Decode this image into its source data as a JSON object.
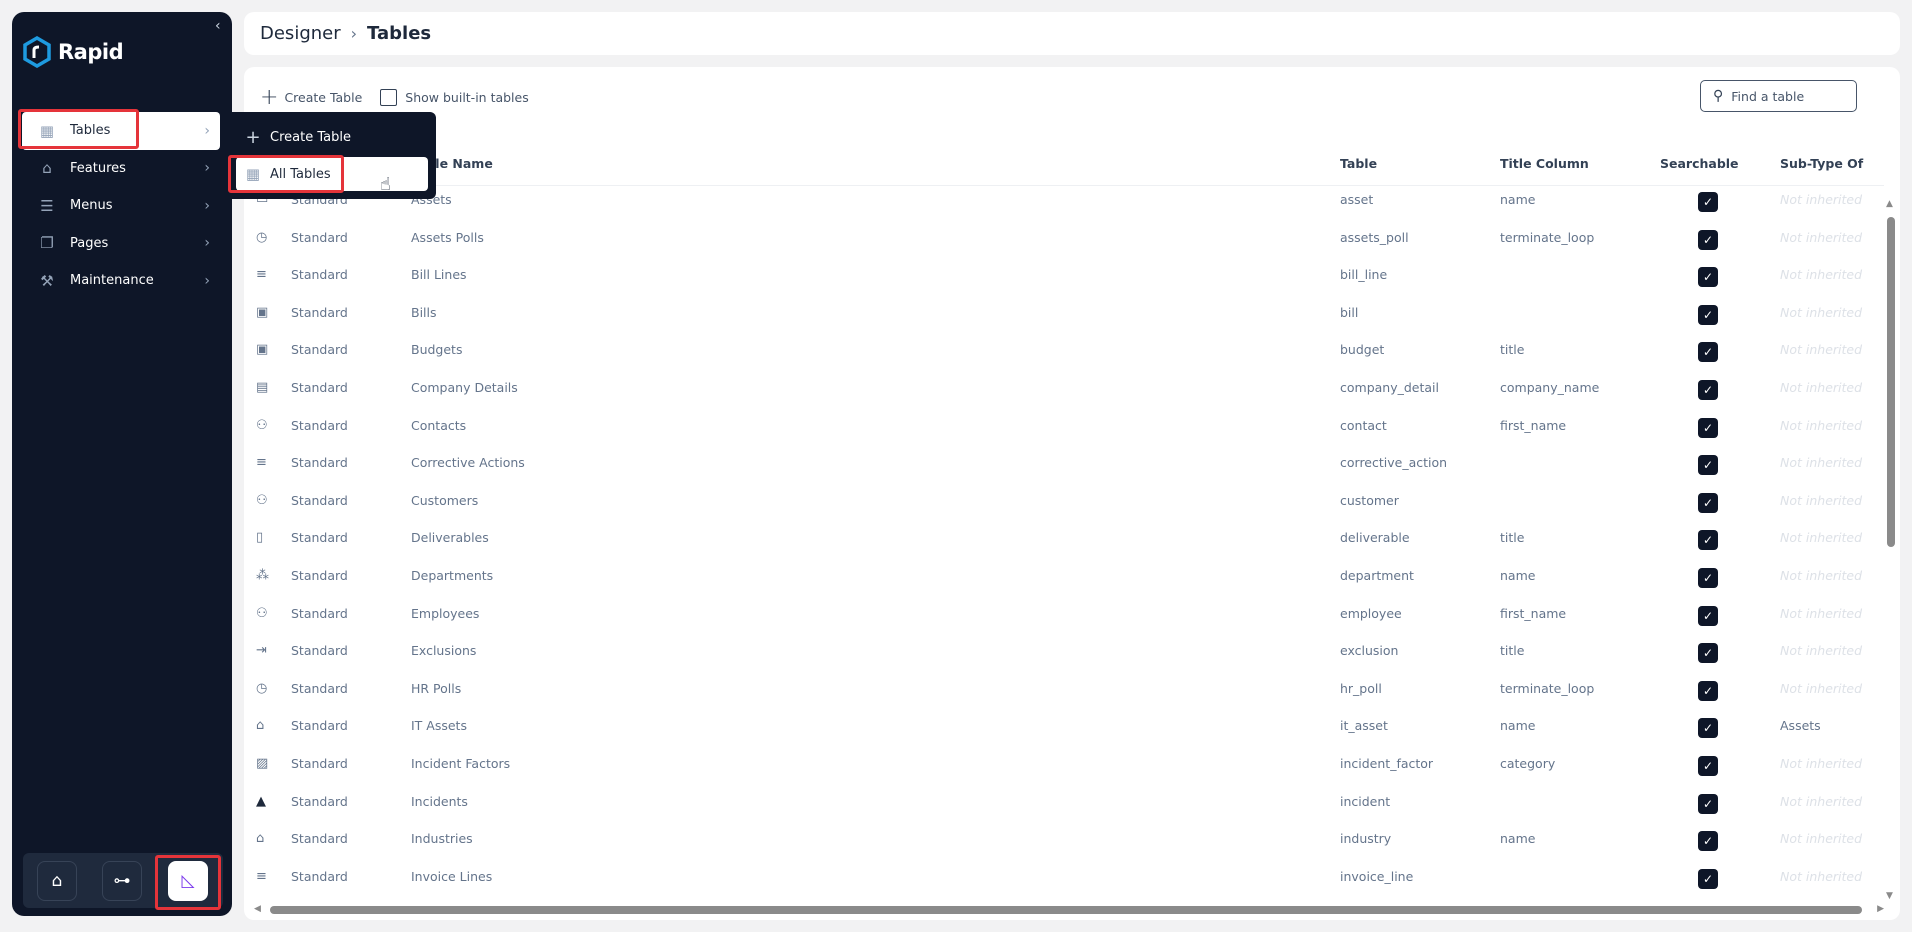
{
  "brand": {
    "name": "Rapid",
    "accent": "#1e9be0"
  },
  "sidebar": {
    "items": [
      {
        "label": "Tables",
        "icon": "table-icon",
        "glyph": "▦"
      },
      {
        "label": "Features",
        "icon": "features-icon",
        "glyph": "⌂"
      },
      {
        "label": "Menus",
        "icon": "menu-icon",
        "glyph": "☰"
      },
      {
        "label": "Pages",
        "icon": "pages-icon",
        "glyph": "❐"
      },
      {
        "label": "Maintenance",
        "icon": "tools-icon",
        "glyph": "⚒"
      }
    ],
    "flyout": {
      "create": "Create Table",
      "all": "All Tables"
    },
    "tray": [
      {
        "icon": "home-icon",
        "glyph": "⌂"
      },
      {
        "icon": "workflow-icon",
        "glyph": "⊶"
      },
      {
        "icon": "designer-icon",
        "glyph": "◺"
      }
    ]
  },
  "header": {
    "crumb_root": "Designer",
    "crumb_current": "Tables"
  },
  "toolbar": {
    "create_label": "Create Table",
    "show_builtin_label": "Show built-in tables",
    "show_builtin_checked": false,
    "search_placeholder": "Find a table"
  },
  "table": {
    "columns": {
      "name": "Table Name",
      "table": "Table",
      "title": "Title Column",
      "searchable": "Searchable",
      "subtype": "Sub-Type Of"
    },
    "rows": [
      {
        "icon": "box-icon",
        "glyph": "▭",
        "type": "Standard",
        "name": "Assets",
        "table": "asset",
        "title": "name",
        "searchable": true,
        "subtype": "Not inherited"
      },
      {
        "icon": "timer-icon",
        "glyph": "◷",
        "type": "Standard",
        "name": "Assets Polls",
        "table": "assets_poll",
        "title": "terminate_loop",
        "searchable": true,
        "subtype": "Not inherited"
      },
      {
        "icon": "list-add-icon",
        "glyph": "≡",
        "type": "Standard",
        "name": "Bill Lines",
        "table": "bill_line",
        "title": "",
        "searchable": true,
        "subtype": "Not inherited"
      },
      {
        "icon": "money-icon",
        "glyph": "▣",
        "type": "Standard",
        "name": "Bills",
        "table": "bill",
        "title": "",
        "searchable": true,
        "subtype": "Not inherited"
      },
      {
        "icon": "money-icon",
        "glyph": "▣",
        "type": "Standard",
        "name": "Budgets",
        "table": "budget",
        "title": "title",
        "searchable": true,
        "subtype": "Not inherited"
      },
      {
        "icon": "document-list-icon",
        "glyph": "▤",
        "type": "Standard",
        "name": "Company Details",
        "table": "company_detail",
        "title": "company_name",
        "searchable": true,
        "subtype": "Not inherited"
      },
      {
        "icon": "person-icon",
        "glyph": "⚇",
        "type": "Standard",
        "name": "Contacts",
        "table": "contact",
        "title": "first_name",
        "searchable": true,
        "subtype": "Not inherited"
      },
      {
        "icon": "list-bolt-icon",
        "glyph": "≡",
        "type": "Standard",
        "name": "Corrective Actions",
        "table": "corrective_action",
        "title": "",
        "searchable": true,
        "subtype": "Not inherited"
      },
      {
        "icon": "person-check-icon",
        "glyph": "⚇",
        "type": "Standard",
        "name": "Customers",
        "table": "customer",
        "title": "",
        "searchable": true,
        "subtype": "Not inherited"
      },
      {
        "icon": "file-icon",
        "glyph": "▯",
        "type": "Standard",
        "name": "Deliverables",
        "table": "deliverable",
        "title": "title",
        "searchable": true,
        "subtype": "Not inherited"
      },
      {
        "icon": "group-icon",
        "glyph": "⁂",
        "type": "Standard",
        "name": "Departments",
        "table": "department",
        "title": "name",
        "searchable": true,
        "subtype": "Not inherited"
      },
      {
        "icon": "person-badge-icon",
        "glyph": "⚇",
        "type": "Standard",
        "name": "Employees",
        "table": "employee",
        "title": "first_name",
        "searchable": true,
        "subtype": "Not inherited"
      },
      {
        "icon": "exit-icon",
        "glyph": "⇥",
        "type": "Standard",
        "name": "Exclusions",
        "table": "exclusion",
        "title": "title",
        "searchable": true,
        "subtype": "Not inherited"
      },
      {
        "icon": "timer-icon",
        "glyph": "◷",
        "type": "Standard",
        "name": "HR Polls",
        "table": "hr_poll",
        "title": "terminate_loop",
        "searchable": true,
        "subtype": "Not inherited"
      },
      {
        "icon": "building-icon",
        "glyph": "⌂",
        "type": "Standard",
        "name": "IT Assets",
        "table": "it_asset",
        "title": "name",
        "searchable": true,
        "subtype": "Assets"
      },
      {
        "icon": "chart-box-icon",
        "glyph": "▨",
        "type": "Standard",
        "name": "Incident Factors",
        "table": "incident_factor",
        "title": "category",
        "searchable": true,
        "subtype": "Not inherited"
      },
      {
        "icon": "warning-icon",
        "glyph": "▲",
        "type": "Standard",
        "name": "Incidents",
        "table": "incident",
        "title": "",
        "searchable": true,
        "subtype": "Not inherited"
      },
      {
        "icon": "building-icon",
        "glyph": "⌂",
        "type": "Standard",
        "name": "Industries",
        "table": "industry",
        "title": "name",
        "searchable": true,
        "subtype": "Not inherited"
      },
      {
        "icon": "list-add-icon",
        "glyph": "≡",
        "type": "Standard",
        "name": "Invoice Lines",
        "table": "invoice_line",
        "title": "",
        "searchable": true,
        "subtype": "Not inherited"
      }
    ]
  }
}
